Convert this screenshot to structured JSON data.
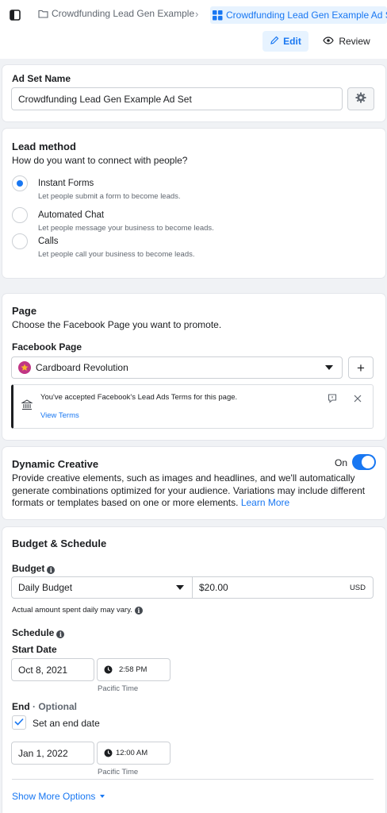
{
  "breadcrumb": {
    "campaign": "Crowdfunding Lead Gen Example",
    "ad_set": "Crowdfunding Lead Gen Example Ad Set"
  },
  "mode": {
    "edit_label": "Edit",
    "review_label": "Review"
  },
  "ad_set_name": {
    "label": "Ad Set Name",
    "value": "Crowdfunding Lead Gen Example Ad Set"
  },
  "lead_method": {
    "title": "Lead method",
    "subtitle": "How do you want to connect with people?",
    "options": [
      {
        "label": "Instant Forms",
        "description": "Let people submit a form to become leads.",
        "selected": true
      },
      {
        "label": "Automated Chat",
        "description": "Let people message your business to become leads.",
        "selected": false
      },
      {
        "label": "Calls",
        "description": "Let people call your business to become leads.",
        "selected": false
      }
    ]
  },
  "page": {
    "title": "Page",
    "subtitle": "Choose the Facebook Page you want to promote.",
    "field_label": "Facebook Page",
    "selected_page": "Cardboard Revolution",
    "notice_text": "You've accepted Facebook's Lead Ads Terms for this page.",
    "notice_link": "View Terms"
  },
  "dynamic_creative": {
    "title": "Dynamic Creative",
    "toggle_label": "On",
    "enabled": true,
    "description": "Provide creative elements, such as images and headlines, and we'll automatically generate combinations optimized for your audience. Variations may include different formats or templates based on one or more elements.",
    "learn_more": "Learn More"
  },
  "budget_schedule": {
    "title": "Budget & Schedule",
    "budget_label": "Budget",
    "budget_type": "Daily Budget",
    "amount": "$20.00",
    "currency": "USD",
    "budget_note": "Actual amount spent daily may vary.",
    "schedule_label": "Schedule",
    "start_label": "Start Date",
    "start_date": "Oct 8, 2021",
    "start_time": "2:58 PM",
    "start_tz": "Pacific Time",
    "end_label": "End",
    "end_optional": "· Optional",
    "set_end_label": "Set an end date",
    "set_end_checked": true,
    "end_date": "Jan 1, 2022",
    "end_time": "12:00 AM",
    "end_tz": "Pacific Time",
    "show_more": "Show More Options"
  },
  "colors": {
    "accent": "#1877f2",
    "text": "#1c1e21",
    "muted": "#606770",
    "background": "#f0f2f5"
  }
}
